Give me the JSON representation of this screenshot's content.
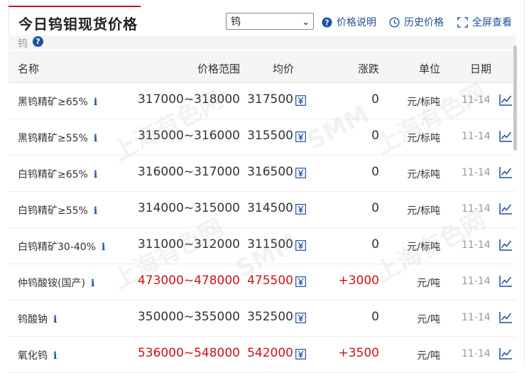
{
  "header": {
    "title": "今日钨钼现货价格",
    "selected_metal": "钨",
    "links": [
      {
        "label": "价格说明",
        "icon": "question-circle-icon"
      },
      {
        "label": "历史价格",
        "icon": "clock-icon"
      },
      {
        "label": "全屏查看",
        "icon": "fullscreen-icon"
      }
    ]
  },
  "section": {
    "label": "钨"
  },
  "table": {
    "columns": {
      "name": "名称",
      "range": "价格范围",
      "avg": "均价",
      "change": "涨跌",
      "unit": "单位",
      "date": "日期"
    },
    "rows": [
      {
        "name": "黑钨精矿≥65%",
        "range": "317000~318000",
        "avg": "317500",
        "change": "0",
        "unit": "元/标吨",
        "date": "11-14",
        "up": false
      },
      {
        "name": "黑钨精矿≥55%",
        "range": "315000~316000",
        "avg": "315500",
        "change": "0",
        "unit": "元/标吨",
        "date": "11-14",
        "up": false
      },
      {
        "name": "白钨精矿≥65%",
        "range": "316000~317000",
        "avg": "316500",
        "change": "0",
        "unit": "元/标吨",
        "date": "11-14",
        "up": false
      },
      {
        "name": "白钨精矿≥55%",
        "range": "314000~315000",
        "avg": "314500",
        "change": "0",
        "unit": "元/标吨",
        "date": "11-14",
        "up": false
      },
      {
        "name": "白钨精矿30-40%",
        "range": "311000~312000",
        "avg": "311500",
        "change": "0",
        "unit": "元/标吨",
        "date": "11-14",
        "up": false
      },
      {
        "name": "仲钨酸铵(国产)",
        "range": "473000~478000",
        "avg": "475500",
        "change": "+3000",
        "unit": "元/吨",
        "date": "11-14",
        "up": true
      },
      {
        "name": "钨酸钠",
        "range": "350000~355000",
        "avg": "352500",
        "change": "0",
        "unit": "元/吨",
        "date": "11-14",
        "up": false
      },
      {
        "name": "氧化钨",
        "range": "536000~548000",
        "avg": "542000",
        "change": "+3500",
        "unit": "元/吨",
        "date": "11-14",
        "up": true
      }
    ]
  },
  "watermark": {
    "brand": "SMM",
    "text": "上海有色网"
  },
  "colors": {
    "accent": "#c8141c",
    "link": "#1f4f9a",
    "up": "#c8141c"
  }
}
